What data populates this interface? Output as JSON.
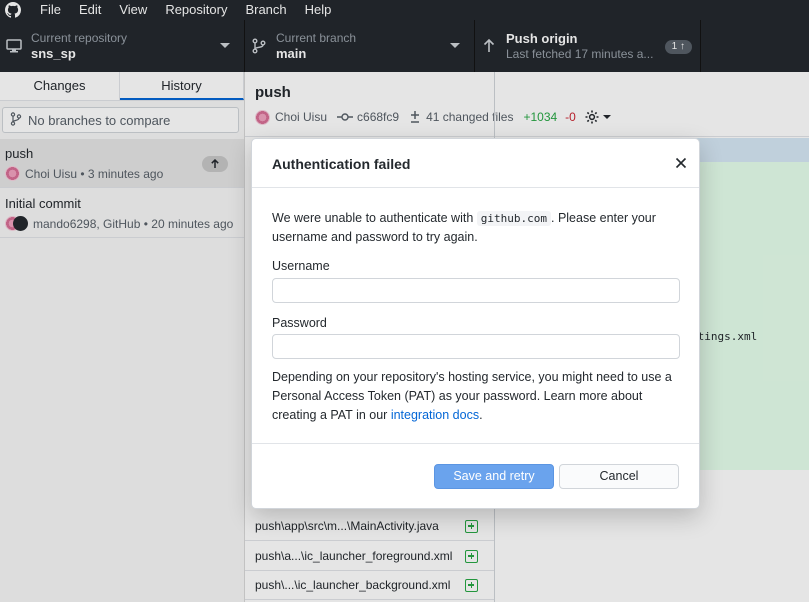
{
  "menu": [
    "File",
    "Edit",
    "View",
    "Repository",
    "Branch",
    "Help"
  ],
  "toolbar": {
    "repo_label": "Current repository",
    "repo_value": "sns_sp",
    "branch_label": "Current branch",
    "branch_value": "main",
    "push_label": "Push origin",
    "push_sub": "Last fetched 17 minutes a...",
    "push_badge": "1 ↑"
  },
  "sidebar": {
    "tabs": [
      "Changes",
      "History"
    ],
    "active_tab": "History",
    "compare_placeholder": "No branches to compare",
    "commits": [
      {
        "title": "push",
        "meta": "Choi Uisu • 3 minutes ago"
      },
      {
        "title": "Initial commit",
        "meta": "mando6298, GitHub • 20 minutes ago"
      }
    ]
  },
  "main": {
    "title": "push",
    "author": "Choi Uisu",
    "sha": "c668fc9",
    "changed_files": "41 changed files",
    "additions": "+1034",
    "deletions": "-0",
    "diff_fragment": "ctings.xml",
    "files": [
      "push\\app\\src\\m...\\MainActivity.java",
      "push\\a...\\ic_launcher_foreground.xml",
      "push\\...\\ic_launcher_background.xml"
    ]
  },
  "dialog": {
    "title": "Authentication failed",
    "msg_before": "We were unable to authenticate with ",
    "msg_code": "github.com",
    "msg_after": ". Please enter your username and password to try again.",
    "username_label": "Username",
    "password_label": "Password",
    "note_before": "Depending on your repository's hosting service, you might need to use a Personal Access Token (PAT) as your password. Learn more about creating a PAT in our ",
    "note_link": "integration docs",
    "note_after": ".",
    "save_button": "Save and retry",
    "cancel_button": "Cancel"
  },
  "colors": {
    "accent": "#0366d6",
    "primary_button": "#6aa3ed",
    "added": "#28a745",
    "removed": "#cb2431",
    "dark_bar": "#24292e"
  }
}
